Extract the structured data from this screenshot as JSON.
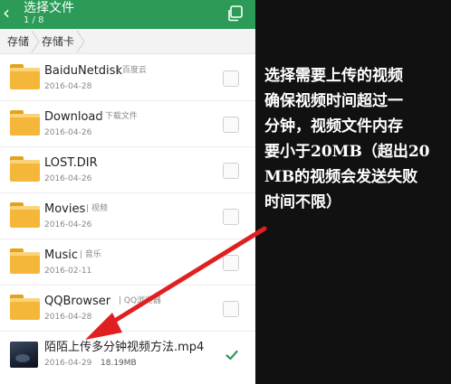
{
  "header": {
    "title": "选择文件",
    "count": "1 / 8"
  },
  "breadcrumb": [
    "存储",
    "存储卡"
  ],
  "files": [
    {
      "name": "BaiduNetdisk",
      "tag": "百度云",
      "date": "2016-04-28",
      "type": "folder",
      "checked": false
    },
    {
      "name": "Download",
      "tag": "下载文件",
      "date": "2016-04-26",
      "type": "folder",
      "checked": false
    },
    {
      "name": "LOST.DIR",
      "tag": "",
      "date": "2016-04-26",
      "type": "folder",
      "checked": false
    },
    {
      "name": "Movies",
      "tag": "视频",
      "date": "2016-04-26",
      "type": "folder",
      "checked": false
    },
    {
      "name": "Music",
      "tag": "音乐",
      "date": "2016-02-11",
      "type": "folder",
      "checked": false
    },
    {
      "name": "QQBrowser",
      "tag": "QQ浏览器",
      "date": "2016-04-28",
      "type": "folder",
      "checked": false
    },
    {
      "name": "陌陌上传多分钟视频方法.mp4",
      "tag": "",
      "date": "2016-04-29",
      "size": "18.19MB",
      "type": "video",
      "checked": true
    }
  ],
  "instructions": {
    "lines": [
      "选择需要上传的视频",
      "确保视频时间超过一",
      "分钟，视频文件内存",
      "要小于20MB（超出20",
      "MB的视频会发送失败",
      "时间不限）"
    ]
  },
  "colors": {
    "accent": "#2b9b57",
    "annotation_arrow": "#e02020",
    "folder": "#f4b73a"
  },
  "icons": {
    "back": "back-arrow-icon",
    "copy": "copy-icon",
    "folder": "folder-icon",
    "check": "check-icon"
  }
}
